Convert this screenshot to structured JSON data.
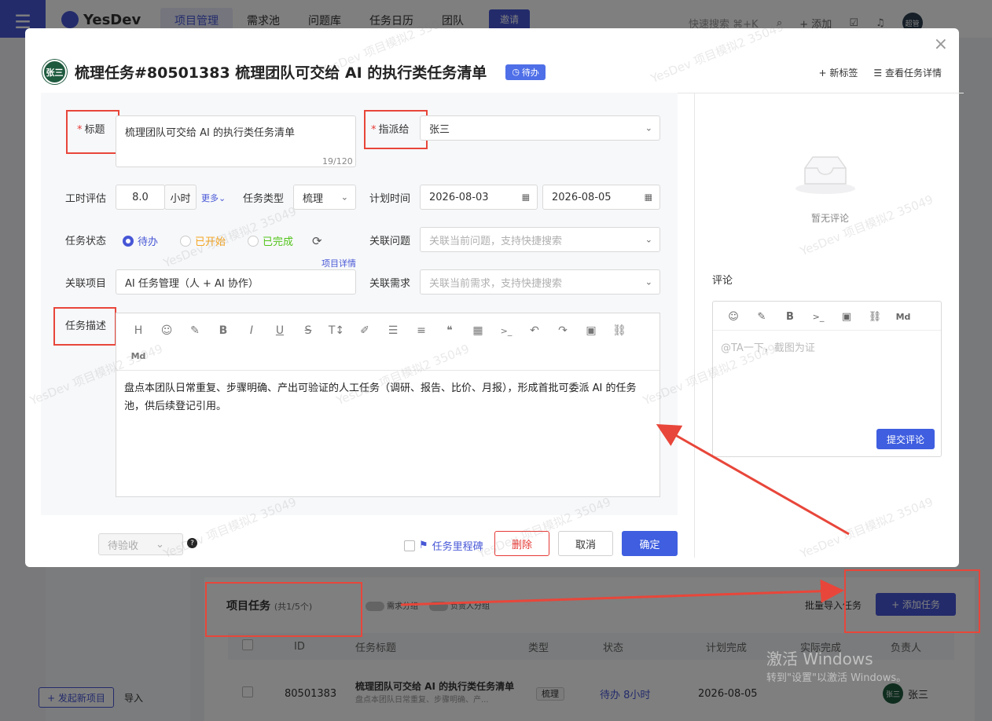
{
  "app": {
    "logo": "YesDev",
    "nav": [
      "项目管理",
      "需求池",
      "问题库",
      "任务日历",
      "团队"
    ],
    "invite": "邀请",
    "quick_search": "快速搜索 ⌘+K",
    "add": "+ 添加",
    "user_badge": "超管"
  },
  "background_page": {
    "section_title": "项目任务",
    "section_count": "(共1/5个)",
    "toggles": [
      "需求分组",
      "负责人分组"
    ],
    "batch_import": "批量导入任务",
    "add_task": "+ 添加任务",
    "columns": [
      "ID",
      "任务标题",
      "类型",
      "状态",
      "计划完成",
      "实际完成",
      "负责人"
    ],
    "row": {
      "id": "80501383",
      "title": "梳理团队可交给 AI 的执行类任务清单",
      "desc": "盘点本团队日常重复、步骤明确、产...",
      "type": "梳理",
      "status": "待办 8小时",
      "plan_done": "2026-08-05",
      "owner": "张三",
      "owner_avatar": "张三"
    },
    "new_project": "+ 发起新项目",
    "import": "导入",
    "windows_line1": "激活 Windows",
    "windows_line2": "转到\"设置\"以激活 Windows。"
  },
  "modal": {
    "avatar": "张三",
    "title": "梳理任务#80501383 梳理团队可交给 AI 的执行类任务清单",
    "status_badge": "待办",
    "new_tag": "+ 新标签",
    "view_detail": "查看任务详情",
    "form": {
      "title_label": "标题",
      "title_value": "梳理团队可交给 AI 的执行类任务清单",
      "title_count": "19/120",
      "assign_label": "指派给",
      "assign_value": "张三",
      "hours_label": "工时评估",
      "hours_value": "8.0",
      "hours_unit": "小时",
      "more": "更多",
      "type_label": "任务类型",
      "type_value": "梳理",
      "plan_label": "计划时间",
      "plan_start": "2026-08-03",
      "plan_end": "2026-08-05",
      "state_label": "任务状态",
      "states": [
        "待办",
        "已开始",
        "已完成"
      ],
      "state_selected": "待办",
      "issue_label": "关联问题",
      "issue_placeholder": "关联当前问题，支持快捷搜索",
      "project_detail": "项目详情",
      "project_label": "关联项目",
      "project_value": "AI 任务管理（人 + AI 协作）",
      "req_label": "关联需求",
      "req_placeholder": "关联当前需求，支持快捷搜索",
      "desc_label": "任务描述",
      "desc_value": "盘点本团队日常重复、步骤明确、产出可验证的人工任务（调研、报告、比价、月报），形成首批可委派 AI 的任务池，供后续登记引用。",
      "toolbar": [
        "H",
        "☺",
        "✎",
        "B",
        "I",
        "U",
        "S",
        "T↕",
        "✐",
        "☰",
        "≡",
        "❝",
        "▦",
        ">_",
        "↶",
        "↷",
        "▣",
        "⛓",
        "Md"
      ]
    },
    "footer": {
      "accept_select": "待验收",
      "milestone": "任务里程碑",
      "delete": "删除",
      "cancel": "取消",
      "confirm": "确定"
    },
    "side": {
      "no_comment": "暂无评论",
      "comment_title": "评论",
      "comment_placeholder": "@TA一下，截图为证",
      "submit": "提交评论",
      "tools": [
        "☺",
        "✎",
        "B",
        ">_",
        "▣",
        "⛓",
        "Md"
      ]
    },
    "watermark": "YesDev 项目模拟2 35049"
  },
  "colors": {
    "primary": "#4757d6",
    "danger": "#e53935",
    "annotation_red": "#e8463a",
    "started": "#f5a623",
    "done": "#52c41a"
  }
}
